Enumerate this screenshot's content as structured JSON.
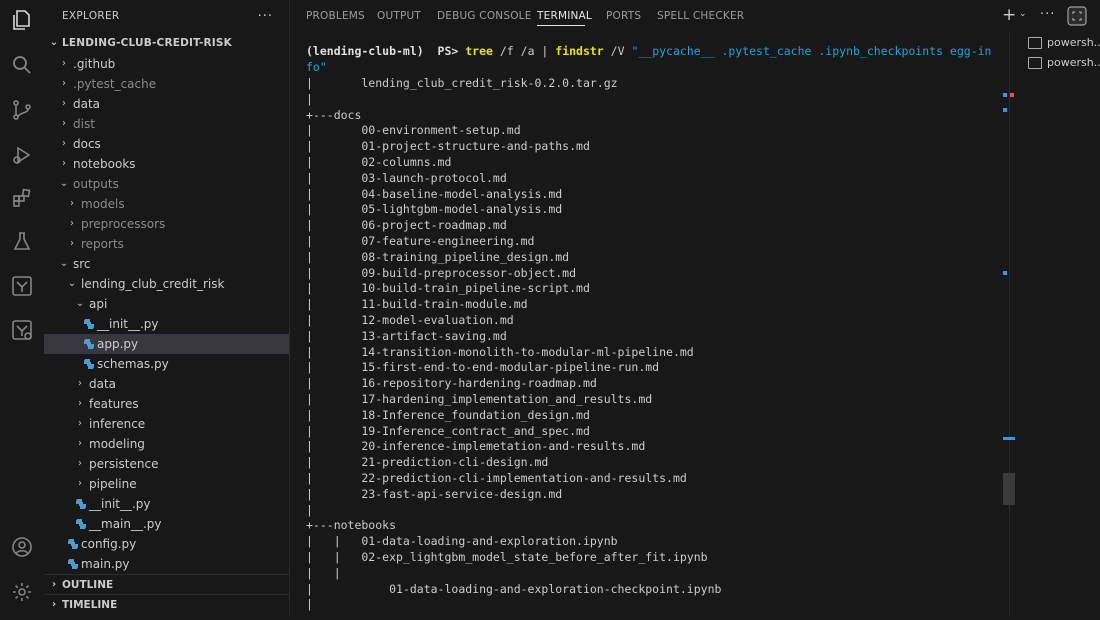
{
  "activity_bar": [
    "explorer-icon",
    "search-icon",
    "source-control-icon",
    "run-debug-icon",
    "extensions-icon",
    "testing-icon",
    "ml-icon",
    "ml-alt-icon",
    "account-icon",
    "settings-icon"
  ],
  "explorer": {
    "title": "EXPLORER",
    "more": "···",
    "root": "LENDING-CLUB-CREDIT-RISK",
    "rows": [
      {
        "label": ".github",
        "depth": 1,
        "type": "folder",
        "open": false,
        "dim": false
      },
      {
        "label": ".pytest_cache",
        "depth": 1,
        "type": "folder",
        "open": false,
        "dim": true
      },
      {
        "label": "data",
        "depth": 1,
        "type": "folder",
        "open": false,
        "dim": false
      },
      {
        "label": "dist",
        "depth": 1,
        "type": "folder",
        "open": false,
        "dim": true
      },
      {
        "label": "docs",
        "depth": 1,
        "type": "folder",
        "open": false,
        "dim": false
      },
      {
        "label": "notebooks",
        "depth": 1,
        "type": "folder",
        "open": false,
        "dim": false
      },
      {
        "label": "outputs",
        "depth": 1,
        "type": "folder",
        "open": true,
        "dim": true
      },
      {
        "label": "models",
        "depth": 2,
        "type": "folder",
        "open": false,
        "dim": true
      },
      {
        "label": "preprocessors",
        "depth": 2,
        "type": "folder",
        "open": false,
        "dim": true
      },
      {
        "label": "reports",
        "depth": 2,
        "type": "folder",
        "open": false,
        "dim": true
      },
      {
        "label": "src",
        "depth": 1,
        "type": "folder",
        "open": true,
        "dim": false
      },
      {
        "label": "lending_club_credit_risk",
        "depth": 2,
        "type": "folder",
        "open": true,
        "dim": false
      },
      {
        "label": "api",
        "depth": 3,
        "type": "folder",
        "open": true,
        "dim": false
      },
      {
        "label": "__init__.py",
        "depth": 4,
        "type": "py",
        "open": false,
        "dim": false
      },
      {
        "label": "app.py",
        "depth": 4,
        "type": "py",
        "open": false,
        "dim": false,
        "selected": true
      },
      {
        "label": "schemas.py",
        "depth": 4,
        "type": "py",
        "open": false,
        "dim": false
      },
      {
        "label": "data",
        "depth": 3,
        "type": "folder",
        "open": false,
        "dim": false
      },
      {
        "label": "features",
        "depth": 3,
        "type": "folder",
        "open": false,
        "dim": false
      },
      {
        "label": "inference",
        "depth": 3,
        "type": "folder",
        "open": false,
        "dim": false
      },
      {
        "label": "modeling",
        "depth": 3,
        "type": "folder",
        "open": false,
        "dim": false
      },
      {
        "label": "persistence",
        "depth": 3,
        "type": "folder",
        "open": false,
        "dim": false
      },
      {
        "label": "pipeline",
        "depth": 3,
        "type": "folder",
        "open": false,
        "dim": false
      },
      {
        "label": "__init__.py",
        "depth": 3,
        "type": "py",
        "open": false,
        "dim": false
      },
      {
        "label": "__main__.py",
        "depth": 3,
        "type": "py",
        "open": false,
        "dim": false
      },
      {
        "label": "config.py",
        "depth": 2,
        "type": "py",
        "open": false,
        "dim": false
      },
      {
        "label": "main.py",
        "depth": 2,
        "type": "py",
        "open": false,
        "dim": false
      }
    ],
    "outline": "OUTLINE",
    "timeline": "TIMELINE"
  },
  "panel_tabs": [
    "PROBLEMS",
    "OUTPUT",
    "DEBUG CONSOLE",
    "TERMINAL",
    "PORTS",
    "SPELL CHECKER"
  ],
  "active_tab": "TERMINAL",
  "terminal_list": [
    "powersh...",
    "powersh..."
  ],
  "terminal": {
    "prompt": "(lending-club-ml)  PS> ",
    "cmd1": "tree",
    "args1": " /f /a | ",
    "cmd2": "findstr",
    "args2": " /V ",
    "str1": "\"__pycache__ .pytest_cache .ipynb_checkpoints egg-in",
    "str2": "fo\"",
    "lines": [
      "|       lending_club_credit_risk-0.2.0.tar.gz",
      "|",
      "+---docs",
      "|       00-environment-setup.md",
      "|       01-project-structure-and-paths.md",
      "|       02-columns.md",
      "|       03-launch-protocol.md",
      "|       04-baseline-model-analysis.md",
      "|       05-lightgbm-model-analysis.md",
      "|       06-project-roadmap.md",
      "|       07-feature-engineering.md",
      "|       08-training_pipeline_design.md",
      "|       09-build-preprocessor-object.md",
      "|       10-build-train_pipeline-script.md",
      "|       11-build-train-module.md",
      "|       12-model-evaluation.md",
      "|       13-artifact-saving.md",
      "|       14-transition-monolith-to-modular-ml-pipeline.md",
      "|       15-first-end-to-end-modular-pipeline-run.md",
      "|       16-repository-hardening-roadmap.md",
      "|       17-hardening_implementation_and_results.md",
      "|       18-Inference_foundation_design.md",
      "|       19-Inference_contract_and_spec.md",
      "|       20-inference-implemetation-and-results.md",
      "|       21-prediction-cli-design.md",
      "|       22-prediction-cli-implementation-and-results.md",
      "|       23-fast-api-service-design.md",
      "|",
      "+---notebooks",
      "|   |   01-data-loading-and-exploration.ipynb",
      "|   |   02-exp_lightgbm_model_state_before_after_fit.ipynb",
      "|   |",
      "|           01-data-loading-and-exploration-checkpoint.ipynb",
      "|"
    ]
  }
}
